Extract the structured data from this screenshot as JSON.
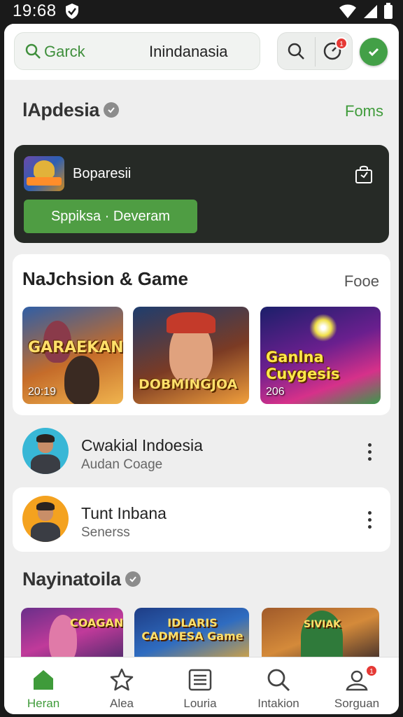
{
  "status": {
    "time": "19:68"
  },
  "topbar": {
    "search_placeholder": "Garck",
    "search_value": "Inindanasia",
    "notif_count": "1"
  },
  "section1": {
    "title": "lApdesia",
    "link": "Foms"
  },
  "promo": {
    "title": "Boparesii",
    "cta": "Sppiksa · Deveram"
  },
  "games": {
    "heading": "NaJchsion & Game",
    "more": "Fooe",
    "tiles": [
      {
        "name": "GARAEKAN",
        "year": "20:19"
      },
      {
        "name": "DOBMINGJOA",
        "year": ""
      },
      {
        "name": "Ganlna Cuygesis",
        "year": "206"
      }
    ]
  },
  "list": [
    {
      "name": "Cwakial Indoesia",
      "sub": "Audan Coage"
    },
    {
      "name": "Tunt Inbana",
      "sub": "Senerss"
    }
  ],
  "section2": {
    "title": "Nayinatoila"
  },
  "strip": [
    {
      "name": "COAGAN"
    },
    {
      "name": "IDLARIS CADMESA Game"
    },
    {
      "name": "SIVIAK"
    }
  ],
  "nav": [
    {
      "label": "Heran",
      "icon": "home-icon",
      "active": true
    },
    {
      "label": "Alea",
      "icon": "star-icon"
    },
    {
      "label": "Louria",
      "icon": "list-icon"
    },
    {
      "label": "Intakion",
      "icon": "search-icon"
    },
    {
      "label": "Sorguan",
      "icon": "profile-icon",
      "badge": "1"
    }
  ],
  "colors": {
    "accent": "#3f9b3a",
    "promo_bg": "#262a26",
    "badge": "#e53935"
  }
}
